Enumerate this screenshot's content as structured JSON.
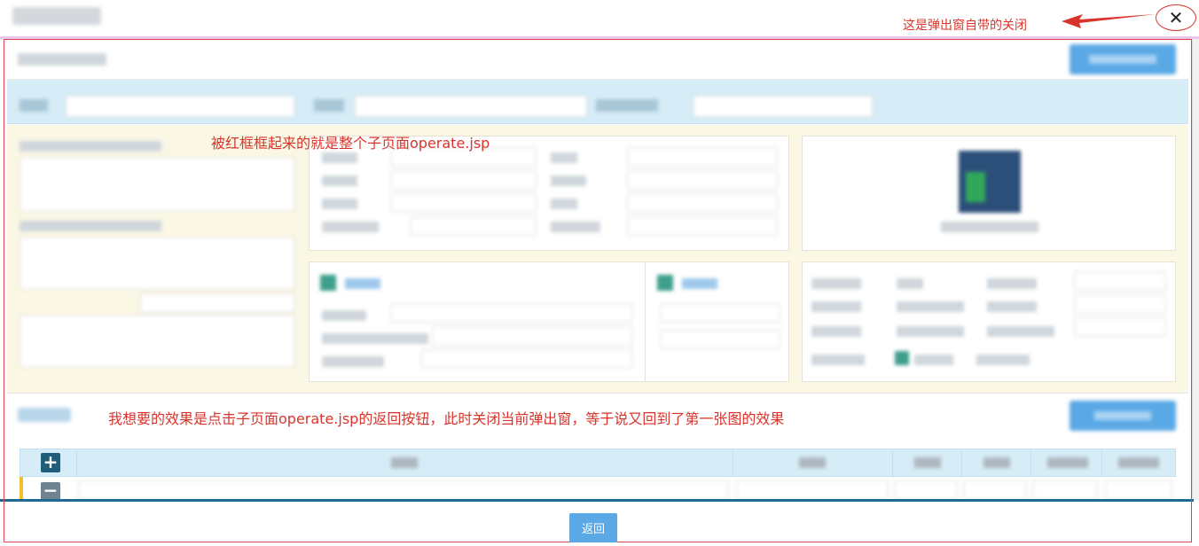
{
  "dialog": {
    "close_glyph": "✕",
    "close_icon": "close-icon"
  },
  "annotations": {
    "close_note": "这是弹出窗自带的关闭",
    "subpage_note": "被红框框起来的就是整个子页面operate.jsp",
    "back_note": "我想要的效果是点击子页面operate.jsp的返回按钮，此时关闭当前弹出窗，等于说又回到了第一张图的效果"
  },
  "table": {
    "add_glyph": "+",
    "remove_glyph": "−"
  },
  "footer": {
    "back_label": "返回"
  },
  "colors": {
    "annotation_red": "#d9342b",
    "button_blue": "#5aa9e6",
    "filter_bar": "#d6ecf6",
    "form_bg": "#fbf7e5",
    "divider": "#1e6a94"
  }
}
